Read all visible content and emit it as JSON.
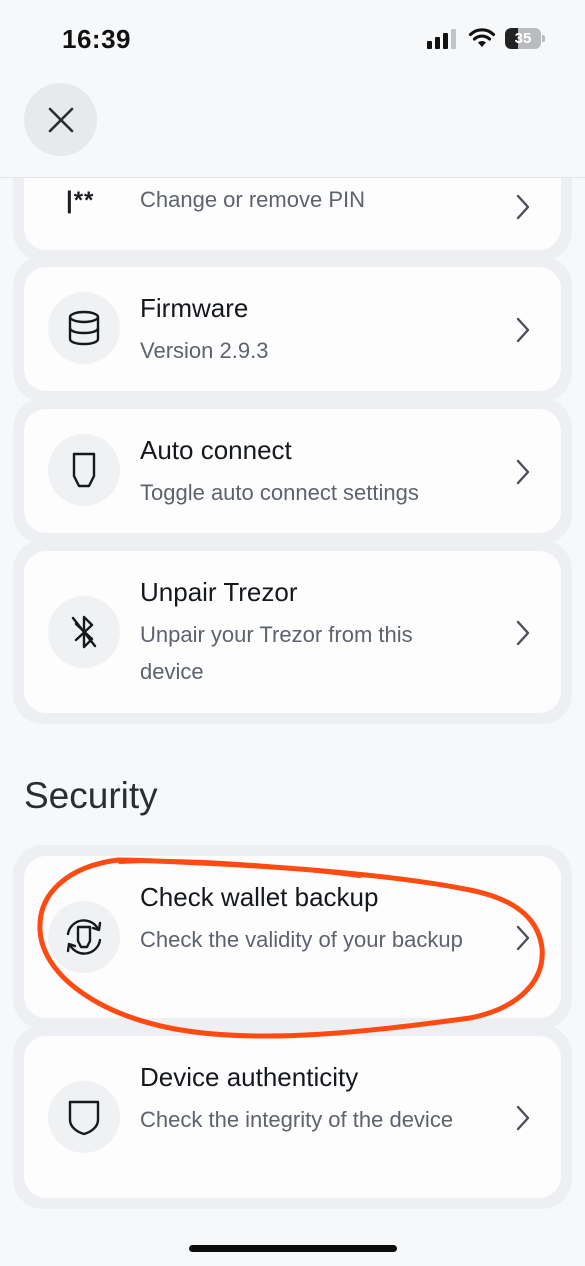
{
  "status_bar": {
    "time": "16:39",
    "battery_level": "35"
  },
  "nav": {
    "close_icon": "close-icon"
  },
  "device_items": [
    {
      "icon": "pin-icon",
      "title": "",
      "subtitle": "Change or remove PIN"
    },
    {
      "icon": "database-icon",
      "title": "Firmware",
      "subtitle": "Version 2.9.3"
    },
    {
      "icon": "trezor-device-icon",
      "title": "Auto connect",
      "subtitle": "Toggle auto connect settings"
    },
    {
      "icon": "bluetooth-off-icon",
      "title": "Unpair Trezor",
      "subtitle": "Unpair your Trezor from this device"
    }
  ],
  "pin_glyph": "|**",
  "security": {
    "title": "Security",
    "items": [
      {
        "icon": "backup-check-icon",
        "title": "Check wallet backup",
        "subtitle": "Check the validity of your backup"
      },
      {
        "icon": "shield-icon",
        "title": "Device authenticity",
        "subtitle": "Check the integrity of the device"
      }
    ]
  },
  "colors": {
    "background": "#f7f8fa",
    "card": "#fdfdfe",
    "card_border": "#eeeff2",
    "annotation": "#ff4a12"
  }
}
